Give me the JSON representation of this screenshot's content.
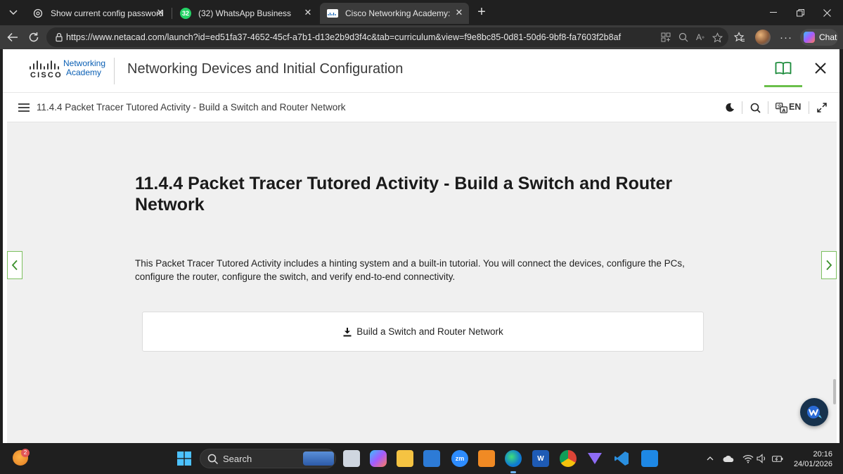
{
  "browser": {
    "tabs": [
      {
        "title": "Show current config passwords",
        "favicon": "openai-icon",
        "active": false
      },
      {
        "title": "(32) WhatsApp Business",
        "favicon": "whatsapp-icon",
        "badge": "32",
        "active": false
      },
      {
        "title": "Cisco Networking Academy: Netw",
        "favicon": "cisco-icon",
        "active": true
      }
    ],
    "url": "https://www.netacad.com/launch?id=ed51fa37-4652-45cf-a7b1-d13e2b9d3f4c&tab=curriculum&view=f9e8bc85-0d81-50d6-9bf8-fa7603f2b8af",
    "chat_label": "Chat"
  },
  "header": {
    "logo_brand": "CISCO",
    "logo_line1": "Networking",
    "logo_line2": "Academy",
    "course_title": "Networking Devices and Initial Configuration"
  },
  "subheader": {
    "lesson_title": "11.4.4 Packet Tracer Tutored Activity - Build a Switch and Router Network",
    "language": "EN"
  },
  "content": {
    "heading": "11.4.4 Packet Tracer Tutored Activity - Build a Switch and Router Network",
    "intro": "This Packet Tracer Tutored Activity includes a hinting system and a built-in tutorial. You will connect the devices, configure the PCs, configure the router, configure the switch, and verify end-to-end connectivity.",
    "download_label": "Build a Switch and Router Network"
  },
  "taskbar": {
    "weather_badge": "2",
    "search_placeholder": "Search",
    "time": "20:16",
    "date": "24/01/2026",
    "apps": [
      "file-explorer-icon",
      "copilot-icon",
      "folder-icon",
      "store-icon",
      "zoom-icon",
      "snipping-icon",
      "edge-icon",
      "word-icon",
      "chrome-icon",
      "vpn-icon",
      "vscode-icon",
      "paint-icon"
    ]
  },
  "colors": {
    "accent_green": "#6abf4b",
    "cisco_blue": "#0a5fb4",
    "content_bg": "#f0f0f0"
  }
}
